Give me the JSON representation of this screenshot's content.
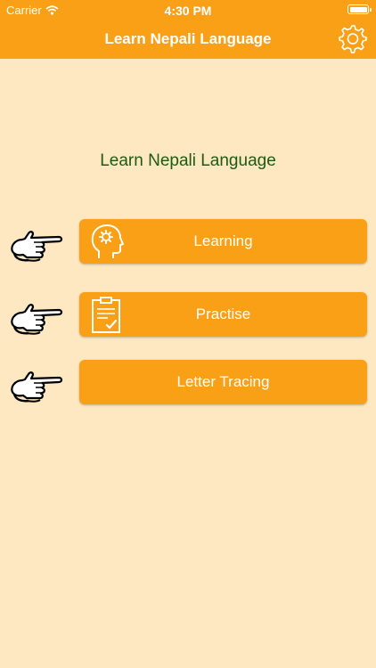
{
  "status_bar": {
    "carrier": "Carrier",
    "time": "4:30 PM"
  },
  "nav": {
    "title": "Learn Nepali Language",
    "settings_icon": "gear-icon"
  },
  "main": {
    "heading": "Learn Nepali Language",
    "buttons": [
      {
        "label": "Learning",
        "icon": "head-gear-icon"
      },
      {
        "label": "Practise",
        "icon": "clipboard-check-icon"
      },
      {
        "label": "Letter Tracing",
        "icon": ""
      }
    ]
  },
  "colors": {
    "accent": "#f9a016",
    "background": "#fde8c1",
    "heading": "#1e5a12"
  }
}
